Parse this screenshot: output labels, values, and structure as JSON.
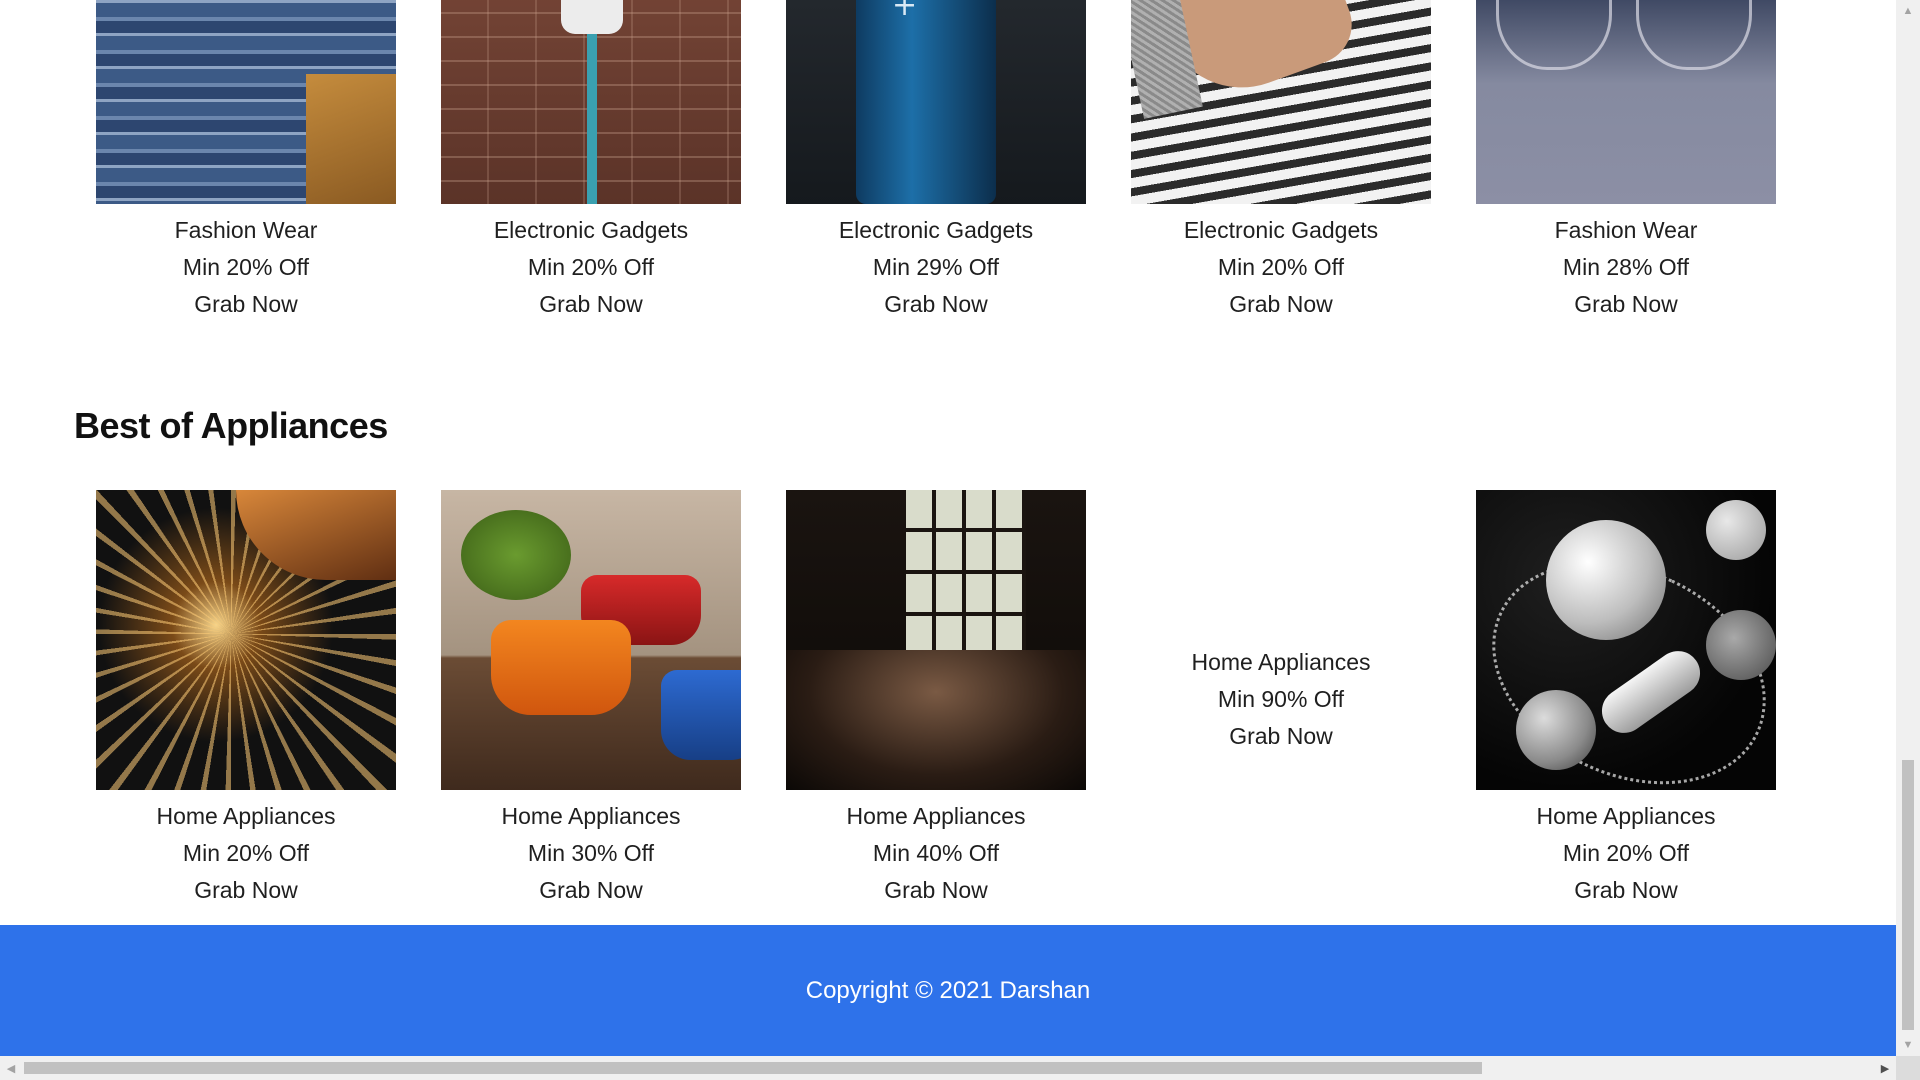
{
  "top_row": [
    {
      "category": "Fashion Wear",
      "discount": "Min 20% Off",
      "cta": "Grab Now",
      "image_icon": "jeans-stack-photo"
    },
    {
      "category": "Electronic Gadgets",
      "discount": "Min 20% Off",
      "cta": "Grab Now",
      "image_icon": "security-camera-photo"
    },
    {
      "category": "Electronic Gadgets",
      "discount": "Min 29% Off",
      "cta": "Grab Now",
      "image_icon": "battery-photo"
    },
    {
      "category": "Electronic Gadgets",
      "discount": "Min 20% Off",
      "cta": "Grab Now",
      "image_icon": "smartphone-in-hand-photo"
    },
    {
      "category": "Fashion Wear",
      "discount": "Min 28% Off",
      "cta": "Grab Now",
      "image_icon": "eyeglasses-photo"
    }
  ],
  "appliances_section": {
    "title": "Best of Appliances",
    "items": [
      {
        "category": "Home Appliances",
        "discount": "Min 20% Off",
        "cta": "Grab Now",
        "image_icon": "grinder-sparks-photo"
      },
      {
        "category": "Home Appliances",
        "discount": "Min 30% Off",
        "cta": "Grab Now",
        "image_icon": "cookware-pots-photo"
      },
      {
        "category": "Home Appliances",
        "discount": "Min 40% Off",
        "cta": "Grab Now",
        "image_icon": "kitchen-window-photo"
      },
      {
        "category": "Home Appliances",
        "discount": "Min 90% Off",
        "cta": "Grab Now",
        "image_icon": ""
      },
      {
        "category": "Home Appliances",
        "discount": "Min 20% Off",
        "cta": "Grab Now",
        "image_icon": "silver-ornaments-photo"
      }
    ]
  },
  "footer": {
    "copyright": "Copyright © 2021 Darshan"
  },
  "colors": {
    "footer_bg": "#2e72ea",
    "footer_text": "#ffffff",
    "page_bg": "#ffffff"
  }
}
